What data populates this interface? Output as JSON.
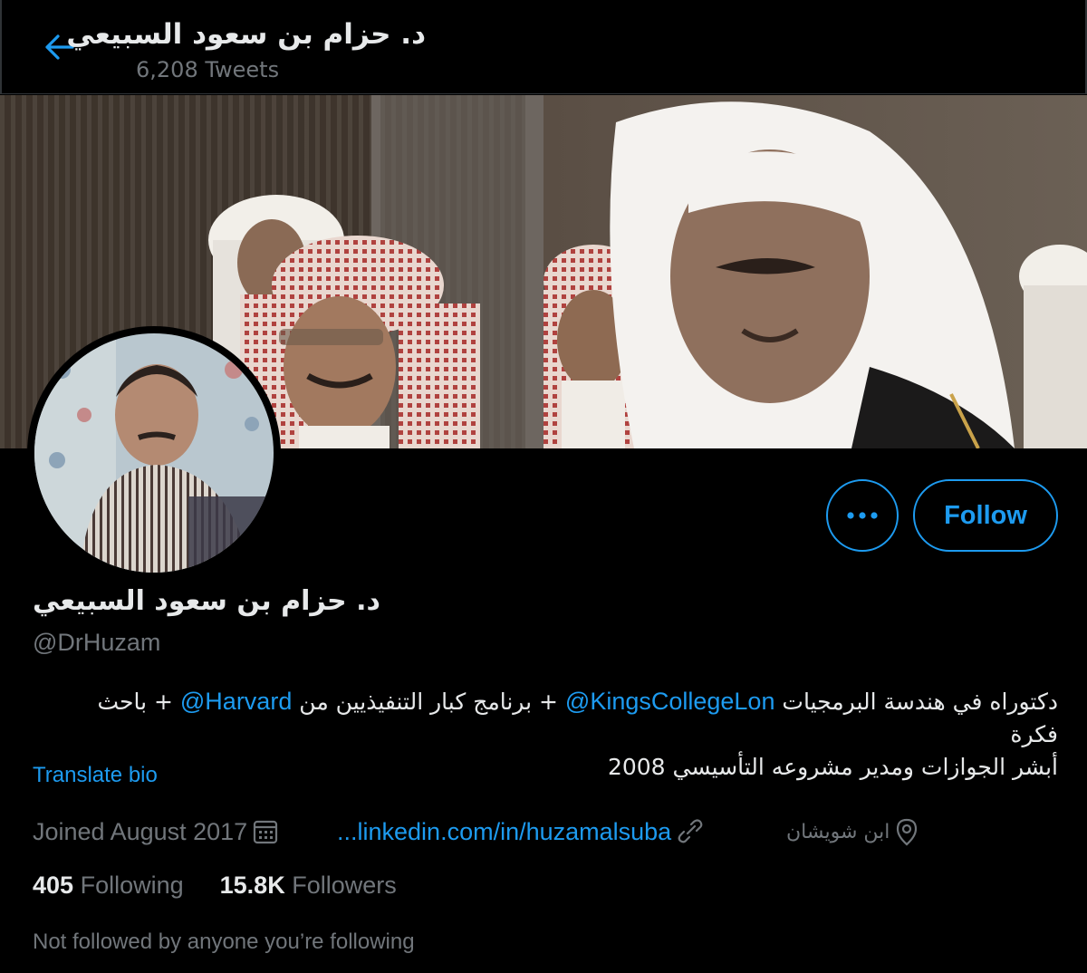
{
  "header": {
    "title": "د. حزام بن سعود السبيعي",
    "tweet_count": "6,208 Tweets"
  },
  "profile": {
    "display_name": "د. حزام بن سعود السبيعي",
    "handle": "@DrHuzam",
    "bio_line1_part1": "دكتوراه في هندسة البرمجيات",
    "bio_mention1": "@KingsCollegeLon",
    "bio_line1_part2": "+ برنامج كبار التنفيذيين من",
    "bio_mention2": "@Harvard",
    "bio_line1_part3": "+ باحث فكرة",
    "bio_line2": "أبشر الجوازات ومدير مشروعه التأسيسي 2008",
    "translate_label": "Translate bio",
    "joined": "Joined August 2017",
    "link": "...linkedin.com/in/huzamalsuba",
    "location": "ابن شويشان",
    "following_count": "405",
    "following_label": "Following",
    "followers_count": "15.8K",
    "followers_label": "Followers",
    "not_followed_text": "Not followed by anyone you’re following"
  },
  "actions": {
    "follow_label": "Follow",
    "more_icon": "ellipsis-icon"
  },
  "icons": {
    "back": "arrow-left-icon",
    "calendar": "calendar-icon",
    "link": "link-icon",
    "location": "location-pin-icon"
  },
  "colors": {
    "accent": "#1d9bf0",
    "background": "#000000",
    "secondary_text": "#71767b",
    "primary_text": "#e7e9ea"
  }
}
